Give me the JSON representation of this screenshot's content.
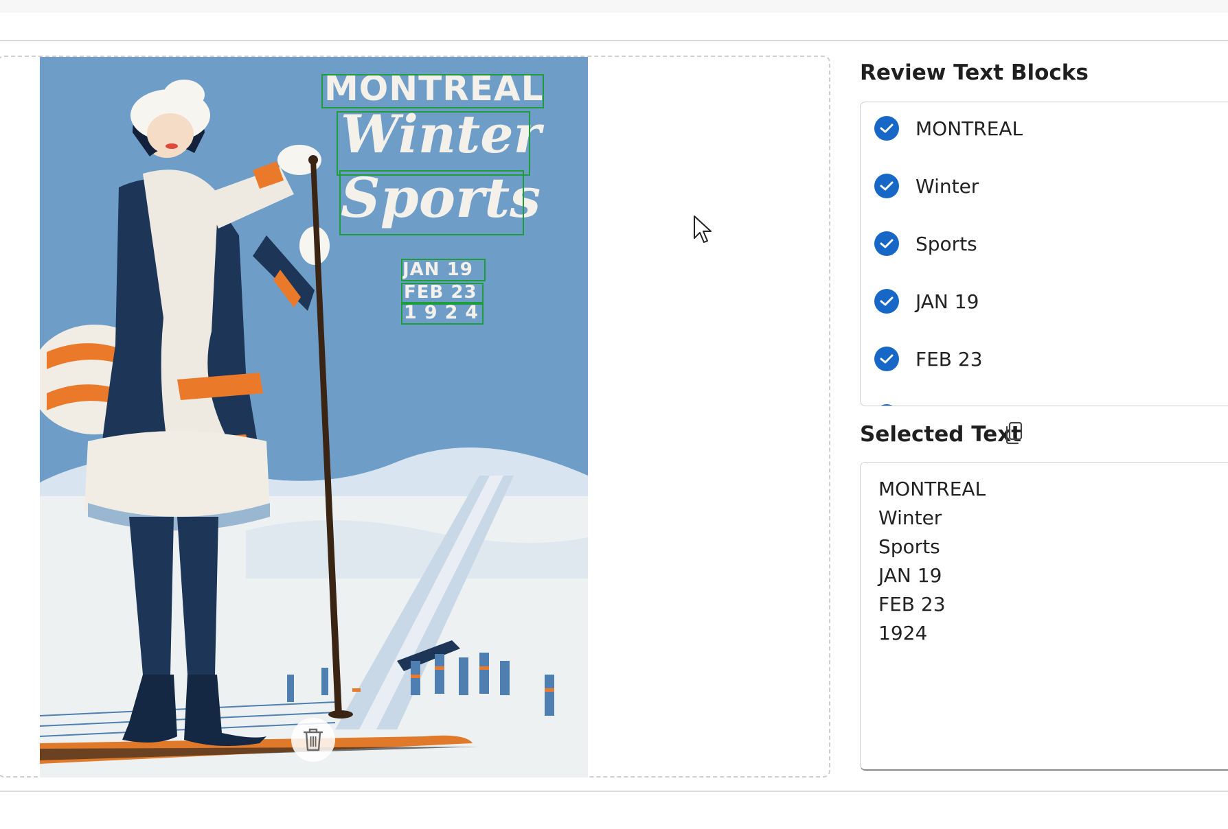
{
  "review": {
    "title": "Review Text Blocks",
    "blocks": [
      {
        "label": "MONTREAL",
        "checked": true
      },
      {
        "label": "Winter",
        "checked": true
      },
      {
        "label": "Sports",
        "checked": true
      },
      {
        "label": "JAN 19",
        "checked": true
      },
      {
        "label": "FEB 23",
        "checked": true
      }
    ]
  },
  "selected": {
    "title": "Selected Text",
    "lines": [
      "MONTREAL",
      "Winter",
      "Sports",
      "JAN 19",
      "FEB 23",
      "1924"
    ]
  },
  "poster": {
    "line1": "MONTREAL",
    "line2": "Winter",
    "line3": "Sports",
    "date1": "JAN 19",
    "date2": "FEB 23",
    "year": "1924"
  },
  "icons": {
    "check": "check-circle-icon",
    "copy": "copy-icon",
    "delete": "trash-icon",
    "cursor": "mouse-pointer-icon"
  },
  "colors": {
    "accent": "#1667c6",
    "ocr_box": "#1e9e3a",
    "poster_sky": "#6e9dc8",
    "poster_navy": "#1d3557",
    "poster_orange": "#ea7a2a"
  }
}
